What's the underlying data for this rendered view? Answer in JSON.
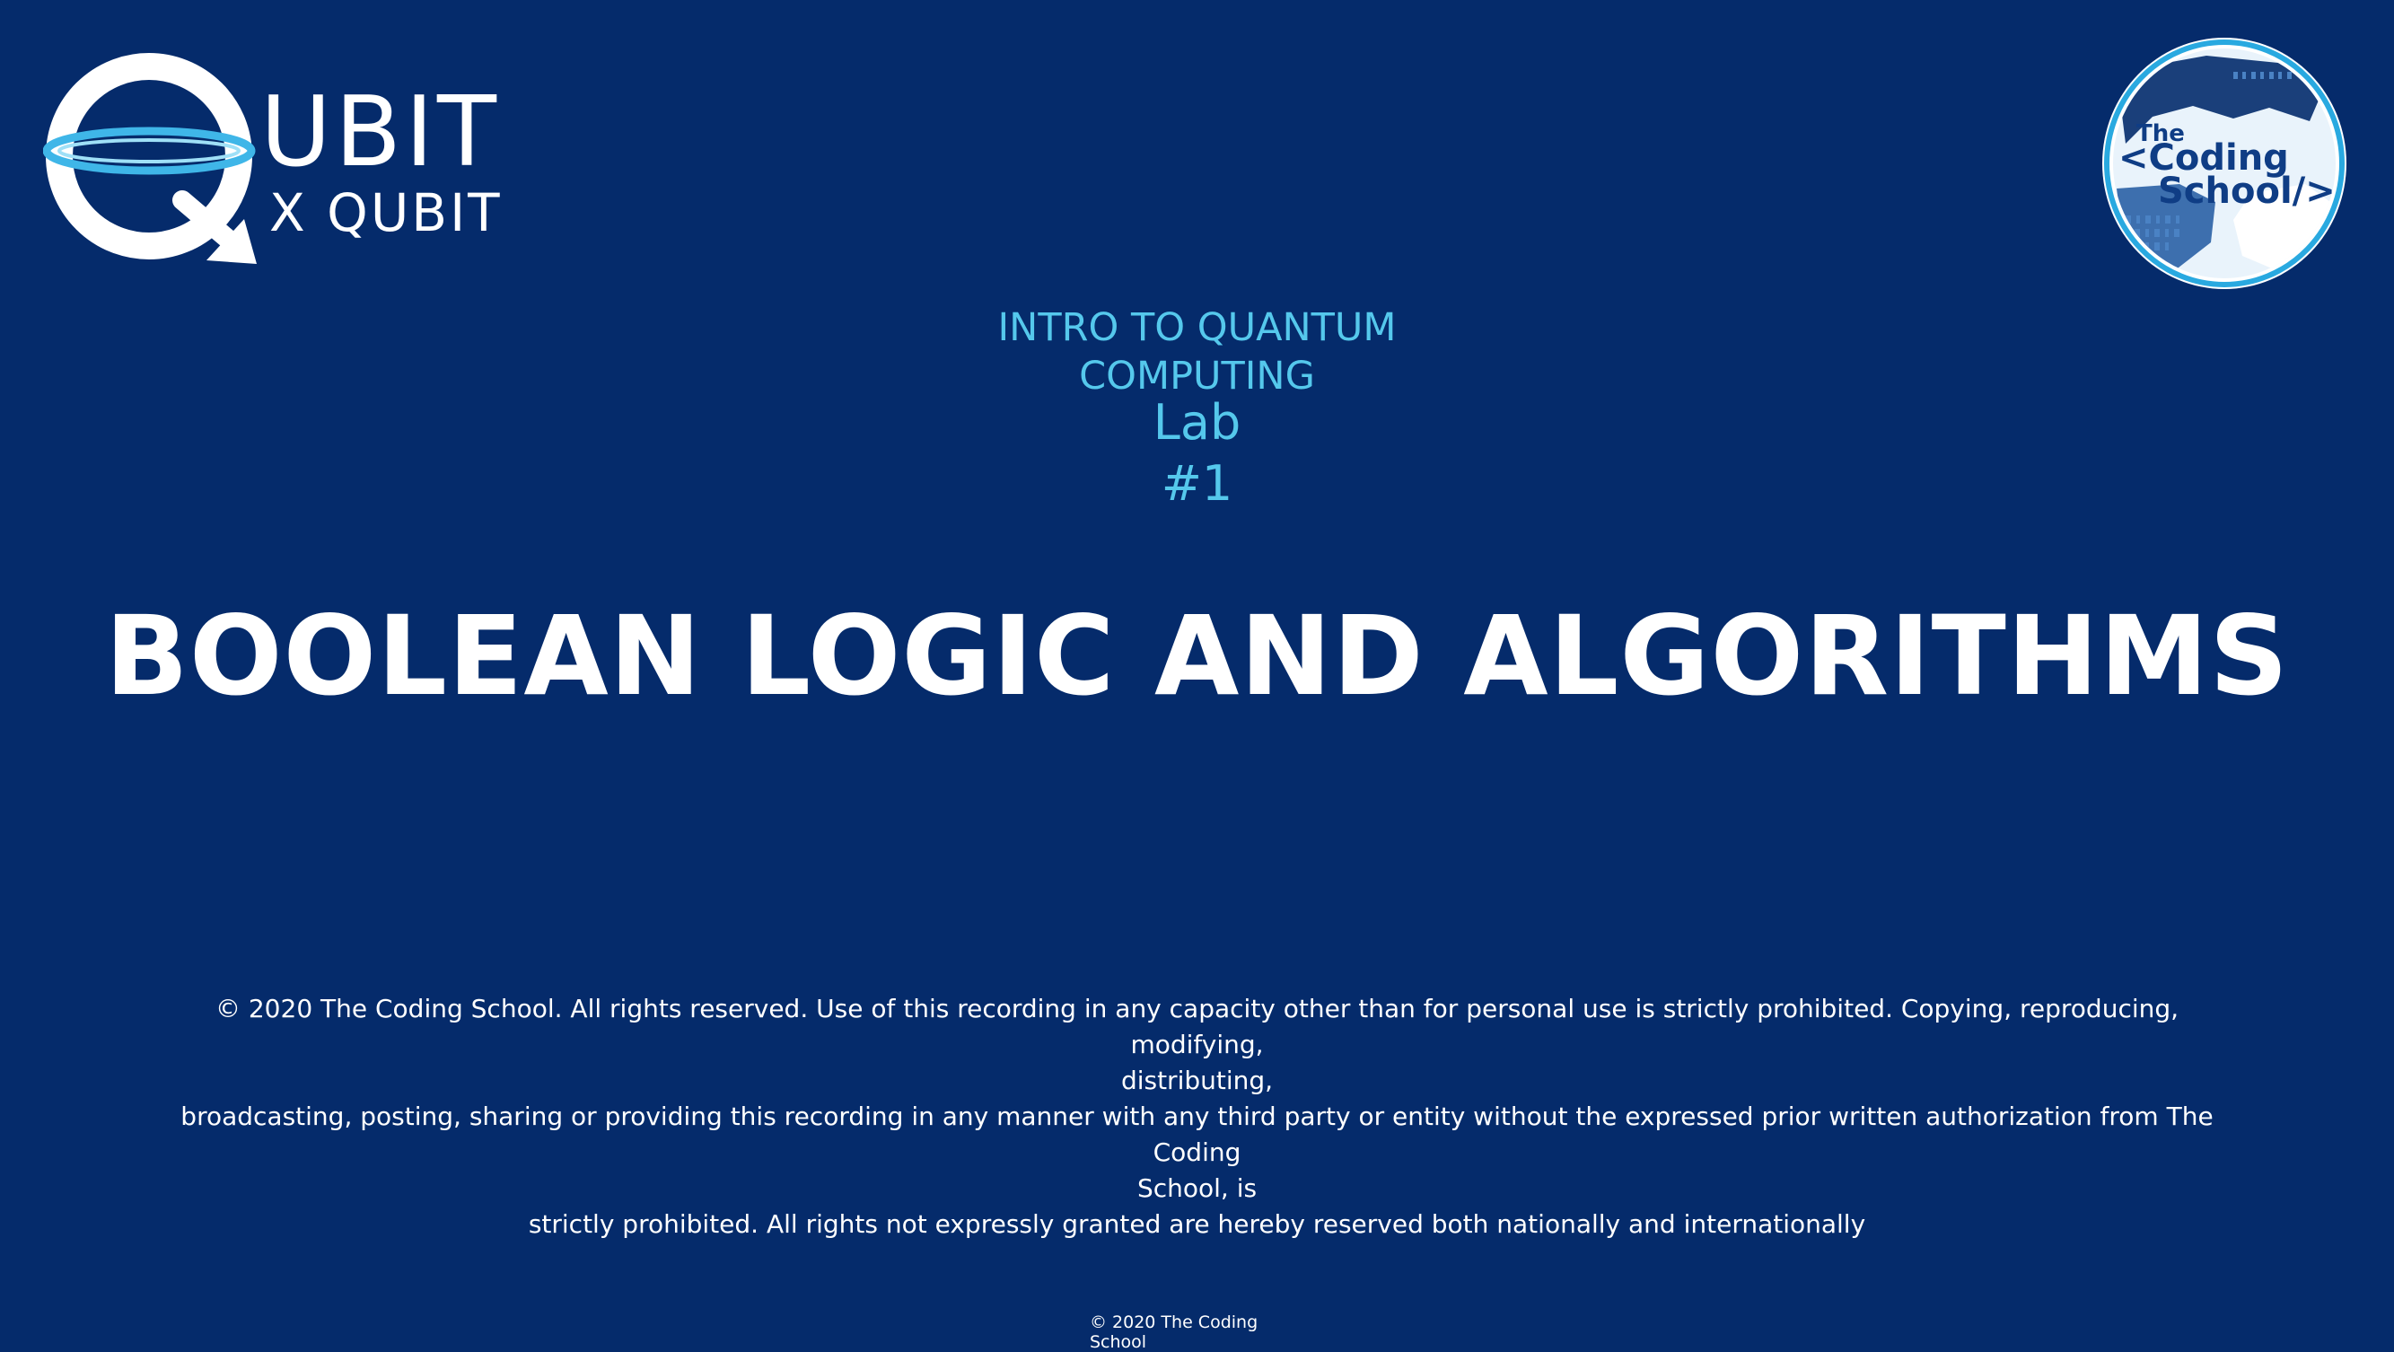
{
  "logos": {
    "qubit_word": "UBIT",
    "qubit_sub": "X QUBIT",
    "school_the": "The",
    "school_coding": "<Coding",
    "school_school": "School/>"
  },
  "subtitle": {
    "line1": "INTRO TO QUANTUM",
    "line2": "COMPUTING",
    "line3": "Lab",
    "line4": "#1"
  },
  "title": "BOOLEAN LOGIC AND ALGORITHMS",
  "notice": {
    "line1": "© 2020 The Coding School. All rights reserved. Use of this recording in any capacity other than for personal use is strictly prohibited. Copying, reproducing, modifying,",
    "line2": "distributing,",
    "line3": "broadcasting, posting, sharing or providing this recording in any manner with any third party or entity without the expressed prior written authorization from The Coding",
    "line4": "School, is",
    "line5": "strictly prohibited. All rights not expressly granted are hereby reserved both nationally and internationally"
  },
  "footer": {
    "line1": "© 2020 The Coding",
    "line2": "School"
  },
  "colors": {
    "background": "#052b6b",
    "accent_cyan": "#55c8ec",
    "text_white": "#ffffff",
    "badge_blue": "#0f3d85"
  }
}
